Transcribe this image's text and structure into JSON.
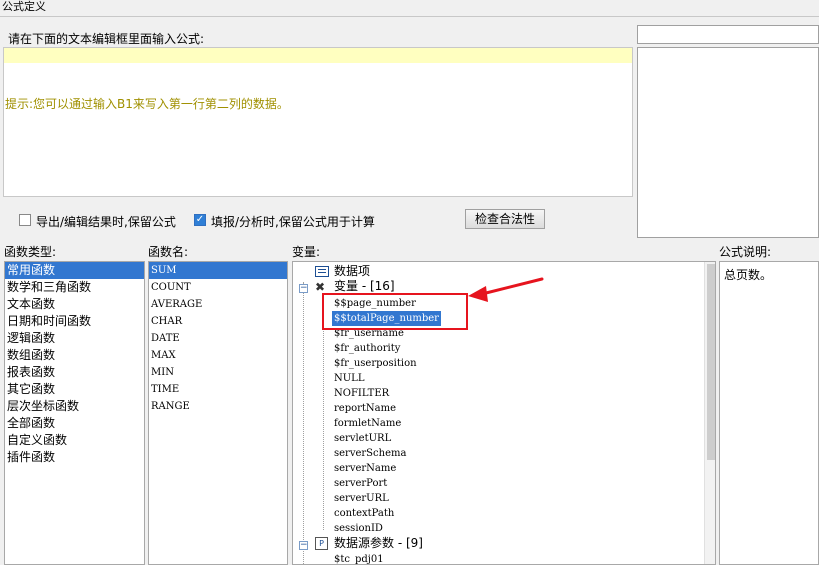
{
  "window": {
    "title": "公式定义"
  },
  "editor": {
    "prompt_label": "请在下面的文本编辑框里面输入公式:",
    "hint": "提示:您可以通过输入B1来写入第一行第二列的数据。"
  },
  "options": {
    "export_keep_formula": {
      "label": "导出/编辑结果时,保留公式",
      "checked": false
    },
    "fill_keep_formula": {
      "label": "填报/分析时,保留公式用于计算",
      "checked": true
    },
    "check_button": "检查合法性"
  },
  "columns": {
    "func_type": "函数类型:",
    "func_name": "函数名:",
    "variables": "变量:",
    "description": "公式说明:"
  },
  "func_types": [
    "常用函数",
    "数学和三角函数",
    "文本函数",
    "日期和时间函数",
    "逻辑函数",
    "数组函数",
    "报表函数",
    "其它函数",
    "层次坐标函数",
    "全部函数",
    "自定义函数",
    "插件函数"
  ],
  "func_names": [
    "SUM",
    "COUNT",
    "AVERAGE",
    "CHAR",
    "DATE",
    "MAX",
    "MIN",
    "TIME",
    "RANGE"
  ],
  "tree": {
    "data_item": "数据项",
    "variables_group": "变量 - [16]",
    "variables": [
      "$$page_number",
      "$$totalPage_number",
      "$fr_username",
      "$fr_authority",
      "$fr_userposition",
      "NULL",
      "NOFILTER",
      "reportName",
      "formletName",
      "servletURL",
      "serverSchema",
      "serverName",
      "serverPort",
      "serverURL",
      "contextPath",
      "sessionID"
    ],
    "datasource_group": "数据源参数 - [9]",
    "datasource_params": [
      "$tc_pdj01"
    ]
  },
  "description": {
    "text": "总页数。"
  },
  "colors": {
    "selection": "#3277d0",
    "hint_text": "#a09000",
    "annotation": "#e6141e",
    "editor_line": "#ffffc0"
  }
}
